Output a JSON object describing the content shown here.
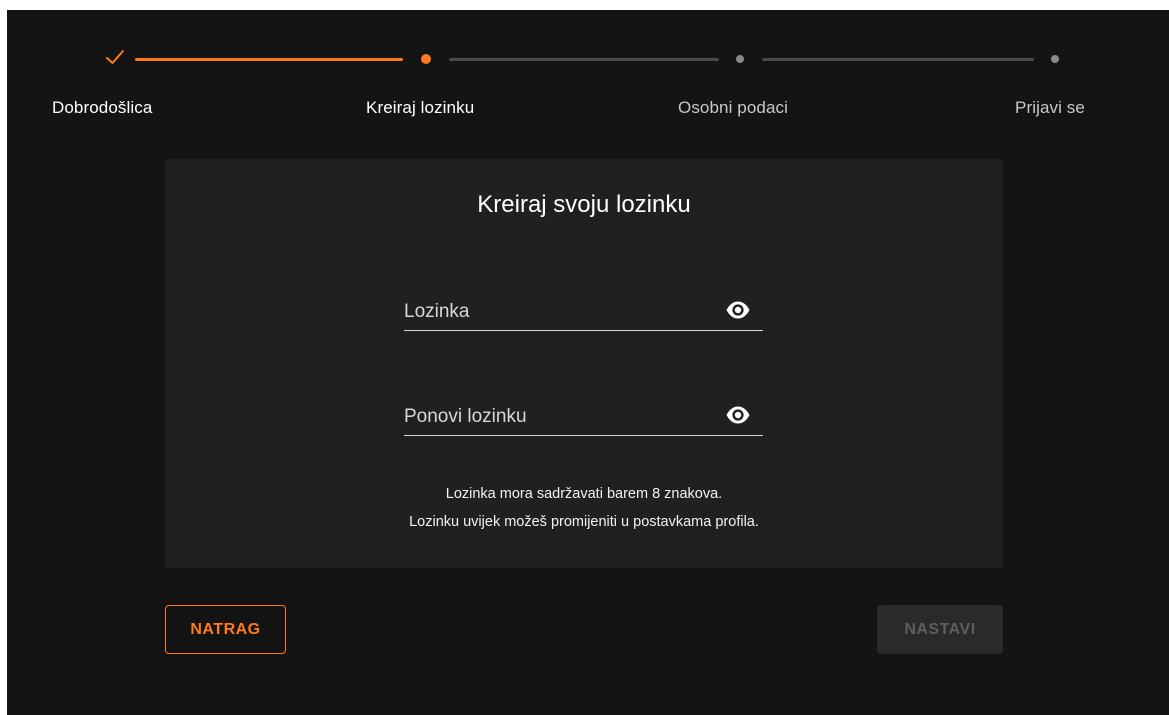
{
  "stepper": {
    "steps": [
      {
        "label": "Dobrodošlica",
        "state": "completed"
      },
      {
        "label": "Kreiraj lozinku",
        "state": "active"
      },
      {
        "label": "Osobni podaci",
        "state": "pending"
      },
      {
        "label": "Prijavi se",
        "state": "pending"
      }
    ],
    "completed_icon": "check-icon"
  },
  "card": {
    "title": "Kreiraj svoju lozinku",
    "password_field": {
      "placeholder": "Lozinka",
      "value": "",
      "icon": "eye-icon"
    },
    "repeat_password_field": {
      "placeholder": "Ponovi lozinku",
      "value": "",
      "icon": "eye-icon"
    },
    "hints": [
      "Lozinka mora sadržavati barem 8 znakova.",
      "Lozinku uvijek možeš promijeniti u postavkama profila."
    ]
  },
  "actions": {
    "back_label": "NATRAG",
    "next_label": "NASTAVI",
    "next_disabled": true
  },
  "colors": {
    "accent": "#ff7a1a",
    "background": "#141414",
    "card": "#202020",
    "inactive_line": "#4a4a4a",
    "disabled_button": "#2a2a2a"
  }
}
